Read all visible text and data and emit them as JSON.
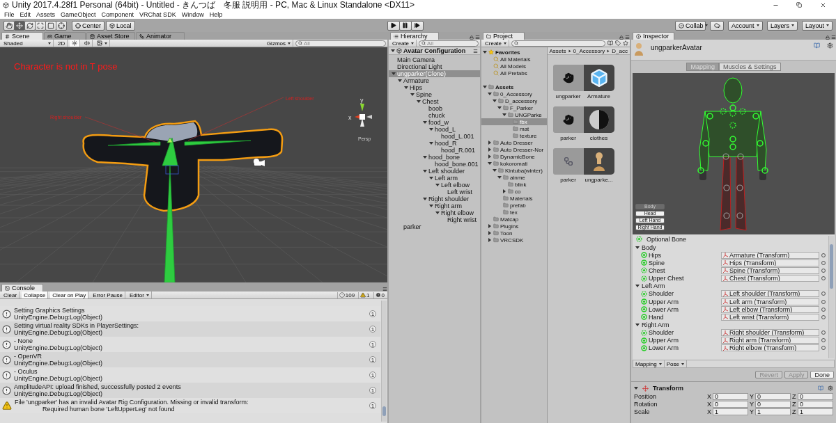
{
  "window": {
    "title": "Unity 2017.4.28f1 Personal (64bit) - Untitled - きんつば　冬服 説明用 - PC, Mac & Linux Standalone <DX11>"
  },
  "menu": [
    "File",
    "Edit",
    "Assets",
    "GameObject",
    "Component",
    "VRChat SDK",
    "Window",
    "Help"
  ],
  "toolbar": {
    "tools": [
      {
        "kind": "hand",
        "selected": false
      },
      {
        "kind": "move",
        "selected": true
      },
      {
        "kind": "rotate",
        "selected": false
      },
      {
        "kind": "scale",
        "selected": false
      },
      {
        "kind": "rect",
        "selected": false
      },
      {
        "kind": "transform",
        "selected": false
      }
    ],
    "pivot": [
      {
        "kind": "pivot",
        "label": "Center"
      },
      {
        "kind": "space",
        "label": "Local"
      }
    ],
    "play": [
      {
        "kind": "play"
      },
      {
        "kind": "pause"
      },
      {
        "kind": "step"
      }
    ],
    "right": [
      {
        "kind": "collab",
        "label": "Collab"
      },
      {
        "kind": "cloud"
      },
      {
        "kind": "dropdown",
        "label": "Account"
      },
      {
        "kind": "dropdown",
        "label": "Layers"
      },
      {
        "kind": "dropdown",
        "label": "Layout"
      }
    ]
  },
  "scene": {
    "tabs": [
      {
        "kind": "scene",
        "label": "Scene",
        "selected": true
      },
      {
        "kind": "game",
        "label": "Game",
        "selected": false
      },
      {
        "kind": "store",
        "label": "Asset Store",
        "selected": false
      },
      {
        "kind": "animator",
        "label": "Animator",
        "selected": false
      }
    ],
    "shading": "Shaded",
    "mode_2d": "2D",
    "lighting_on": true,
    "audio_on": false,
    "gizmos": "Gizmos",
    "search_placeholder": "All",
    "warning": "Character is not in T pose",
    "bone_labels": [
      "Left shoulder",
      "Right shoulder"
    ],
    "axes": [
      "y",
      "x"
    ],
    "projection": "Persp"
  },
  "console": {
    "tab": "Console",
    "buttons": [
      {
        "label": "Clear",
        "on": false
      },
      {
        "label": "Collapse",
        "on": true
      },
      {
        "label": "Clear on Play",
        "on": true
      },
      {
        "label": "Error Pause",
        "on": false
      }
    ],
    "mode": "Editor",
    "counts": [
      {
        "kind": "info",
        "value": "109"
      },
      {
        "kind": "warning",
        "value": "1"
      },
      {
        "kind": "error",
        "value": "0"
      }
    ],
    "entries": [
      {
        "kind": "info",
        "message": "Setting Graphics Settings",
        "trace": "UnityEngine.Debug:Log(Object)",
        "count": "1"
      },
      {
        "kind": "info",
        "message": "Setting virtual reality SDKs in PlayerSettings:",
        "trace": "UnityEngine.Debug:Log(Object)",
        "count": "1"
      },
      {
        "kind": "info",
        "message": "- None",
        "trace": "UnityEngine.Debug:Log(Object)",
        "count": "1"
      },
      {
        "kind": "info",
        "message": "- OpenVR",
        "trace": "UnityEngine.Debug:Log(Object)",
        "count": "1"
      },
      {
        "kind": "info",
        "message": "- Oculus",
        "trace": "UnityEngine.Debug:Log(Object)",
        "count": "1"
      },
      {
        "kind": "info",
        "message": "AmplitudeAPI: upload finished, successfully posted 2 events",
        "trace": "UnityEngine.Debug:Log(Object)",
        "count": "1"
      },
      {
        "kind": "warning",
        "message": "File 'ungparker' has an invalid Avatar Rig Configuration. Missing or invalid transform:",
        "trace": "Required human bone 'LeftUpperLeg' not found",
        "count": "1"
      }
    ]
  },
  "hierarchy": {
    "tab": "Hierarchy",
    "create": "Create",
    "search_placeholder": "All",
    "scene": {
      "label": "Avatar Configuration",
      "expanded": true
    },
    "items": [
      {
        "label": "Main Camera",
        "selected": false
      },
      {
        "label": "Directional Light",
        "selected": false
      },
      {
        "label": "ungparker(Clone)",
        "selected": true,
        "expanded": true,
        "children": [
          {
            "label": "Armature",
            "selected": false,
            "expanded": true,
            "children": [
              {
                "label": "Hips",
                "selected": false,
                "expanded": true,
                "children": [
                  {
                    "label": "Spine",
                    "selected": false,
                    "expanded": true,
                    "children": [
                      {
                        "label": "Chest",
                        "selected": false,
                        "expanded": true,
                        "children": [
                          {
                            "label": "boob",
                            "selected": false
                          },
                          {
                            "label": "chuck",
                            "selected": false
                          },
                          {
                            "label": "food_w",
                            "selected": false,
                            "expanded": true,
                            "children": [
                              {
                                "label": "hood_L",
                                "selected": false,
                                "expanded": true,
                                "children": [
                                  {
                                    "label": "hood_L.001",
                                    "selected": false
                                  }
                                ]
                              },
                              {
                                "label": "hood_R",
                                "selected": false,
                                "expanded": true,
                                "children": [
                                  {
                                    "label": "hood_R.001",
                                    "selected": false
                                  }
                                ]
                              }
                            ]
                          },
                          {
                            "label": "hood_bone",
                            "selected": false,
                            "expanded": true,
                            "children": [
                              {
                                "label": "hood_bone.001",
                                "selected": false
                              }
                            ]
                          },
                          {
                            "label": "Left shoulder",
                            "selected": false,
                            "expanded": true,
                            "children": [
                              {
                                "label": "Left arm",
                                "selected": false,
                                "expanded": true,
                                "children": [
                                  {
                                    "label": "Left elbow",
                                    "selected": false,
                                    "expanded": true,
                                    "children": [
                                      {
                                        "label": "Left wrist",
                                        "selected": false
                                      }
                                    ]
                                  }
                                ]
                              }
                            ]
                          },
                          {
                            "label": "Right shoulder",
                            "selected": false,
                            "expanded": true,
                            "children": [
                              {
                                "label": "Right arm",
                                "selected": false,
                                "expanded": true,
                                "children": [
                                  {
                                    "label": "Right elbow",
                                    "selected": false,
                                    "expanded": true,
                                    "children": [
                                      {
                                        "label": "Right wrist",
                                        "selected": false
                                      }
                                    ]
                                  }
                                ]
                              }
                            ]
                          }
                        ]
                      }
                    ]
                  }
                ]
              }
            ]
          },
          {
            "label": "parker",
            "selected": false
          }
        ]
      }
    ]
  },
  "project": {
    "tab": "Project",
    "create": "Create",
    "tree": [
      {
        "kind": "favorites",
        "label": "Favorites",
        "selected": false,
        "expanded": true,
        "children": [
          {
            "kind": "search",
            "label": "All Materials",
            "selected": false
          },
          {
            "kind": "search",
            "label": "All Models",
            "selected": false
          },
          {
            "kind": "search",
            "label": "All Prefabs",
            "selected": false
          }
        ]
      },
      {
        "kind": "root",
        "label": "Assets",
        "selected": false,
        "expanded": true,
        "children": [
          {
            "kind": "folder",
            "label": "0_Accessory",
            "selected": false,
            "expanded": true,
            "children": [
              {
                "kind": "folder",
                "label": "D_accessory",
                "selected": false,
                "expanded": true,
                "children": [
                  {
                    "kind": "folder",
                    "label": "F_Parker",
                    "selected": false,
                    "expanded": true,
                    "children": [
                      {
                        "kind": "folder",
                        "label": "UNGParke",
                        "selected": false,
                        "expanded": true,
                        "children": [
                          {
                            "kind": "folder",
                            "label": "fbx",
                            "selected": true
                          },
                          {
                            "kind": "folder",
                            "label": "mat",
                            "selected": false
                          },
                          {
                            "kind": "folder",
                            "label": "texture",
                            "selected": false
                          }
                        ]
                      }
                    ]
                  }
                ]
              }
            ]
          },
          {
            "kind": "folder",
            "label": "Auto Dresser",
            "selected": false,
            "expanded": false
          },
          {
            "kind": "folder",
            "label": "Auto Dresser-Nor",
            "selected": false,
            "expanded": false
          },
          {
            "kind": "folder",
            "label": "DynamicBone",
            "selected": false,
            "expanded": false
          },
          {
            "kind": "folder",
            "label": "kokoromati",
            "selected": false,
            "expanded": true,
            "children": [
              {
                "kind": "folder",
                "label": "Kintuba(winter)",
                "selected": false,
                "expanded": true,
                "children": [
                  {
                    "kind": "folder",
                    "label": "ainme",
                    "selected": false,
                    "expanded": true,
                    "children": [
                      {
                        "kind": "folder",
                        "label": "blink",
                        "selected": false
                      },
                      {
                        "kind": "folder",
                        "label": "co",
                        "selected": false,
                        "expanded": false
                      }
                    ]
                  },
                  {
                    "kind": "folder",
                    "label": "Materials",
                    "selected": false
                  },
                  {
                    "kind": "folder",
                    "label": "prefab",
                    "selected": false
                  },
                  {
                    "kind": "folder",
                    "label": "tex",
                    "selected": false
                  }
                ]
              }
            ]
          },
          {
            "kind": "folder",
            "label": "Matcap",
            "selected": false
          },
          {
            "kind": "folder",
            "label": "Plugins",
            "selected": false,
            "expanded": false
          },
          {
            "kind": "folder",
            "label": "Toon",
            "selected": false,
            "expanded": false
          },
          {
            "kind": "folder",
            "label": "VRCSDK",
            "selected": false,
            "expanded": false
          }
        ]
      }
    ],
    "breadcrumb": [
      "Assets",
      "0_Accessory",
      "D_acc"
    ],
    "assets": [
      [
        {
          "kind": "model",
          "label": "ungparker"
        },
        {
          "kind": "prefab",
          "label": "Armature"
        }
      ],
      [
        {
          "kind": "model",
          "label": "parker"
        },
        {
          "kind": "material",
          "label": "clothes"
        }
      ],
      [
        {
          "kind": "mesh",
          "label": "parker"
        },
        {
          "kind": "avatar",
          "label": "ungparke..."
        }
      ]
    ]
  },
  "inspector": {
    "tab": "Inspector",
    "object": "ungparkerAvatar",
    "modes": [
      {
        "label": "Mapping",
        "selected": true
      },
      {
        "label": "Muscles & Settings",
        "selected": false
      }
    ],
    "body_views": [
      {
        "label": "Body",
        "selected": true
      },
      {
        "label": "Head",
        "selected": false
      },
      {
        "label": "Left Hand",
        "selected": false
      },
      {
        "label": "Right Hand",
        "selected": false
      }
    ],
    "legend": "Optional Bone",
    "groups": [
      {
        "name": "Body",
        "expanded": true,
        "bones": [
          {
            "name": "Hips",
            "optional": false,
            "target": "Armature (Transform)"
          },
          {
            "name": "Spine",
            "optional": false,
            "target": "Hips (Transform)"
          },
          {
            "name": "Chest",
            "optional": true,
            "target": "Spine (Transform)"
          },
          {
            "name": "Upper Chest",
            "optional": true,
            "target": "Chest (Transform)"
          }
        ]
      },
      {
        "name": "Left Arm",
        "expanded": true,
        "bones": [
          {
            "name": "Shoulder",
            "optional": true,
            "target": "Left shoulder (Transform)"
          },
          {
            "name": "Upper Arm",
            "optional": false,
            "target": "Left arm (Transform)"
          },
          {
            "name": "Lower Arm",
            "optional": false,
            "target": "Left elbow (Transform)"
          },
          {
            "name": "Hand",
            "optional": false,
            "target": "Left wrist (Transform)"
          }
        ]
      },
      {
        "name": "Right Arm",
        "expanded": true,
        "bones": [
          {
            "name": "Shoulder",
            "optional": true,
            "target": "Right shoulder (Transform)"
          },
          {
            "name": "Upper Arm",
            "optional": false,
            "target": "Right arm (Transform)"
          },
          {
            "name": "Lower Arm",
            "optional": false,
            "target": "Right elbow (Transform)"
          }
        ]
      }
    ],
    "footer": [
      "Mapping",
      "Pose"
    ],
    "actions": [
      {
        "label": "Revert",
        "disabled": true
      },
      {
        "label": "Apply",
        "disabled": true
      },
      {
        "label": "Done",
        "disabled": false
      }
    ],
    "transform": {
      "title": "Transform",
      "expanded": true,
      "rows": [
        {
          "label": "Position",
          "values": [
            {
              "axis": "X",
              "value": "0"
            },
            {
              "axis": "Y",
              "value": "0"
            },
            {
              "axis": "Z",
              "value": "0"
            }
          ]
        },
        {
          "label": "Rotation",
          "values": [
            {
              "axis": "X",
              "value": "0"
            },
            {
              "axis": "Y",
              "value": "0"
            },
            {
              "axis": "Z",
              "value": "0"
            }
          ]
        },
        {
          "label": "Scale",
          "values": [
            {
              "axis": "X",
              "value": "1"
            },
            {
              "axis": "Y",
              "value": "1"
            },
            {
              "axis": "Z",
              "value": "1"
            }
          ]
        }
      ]
    }
  }
}
